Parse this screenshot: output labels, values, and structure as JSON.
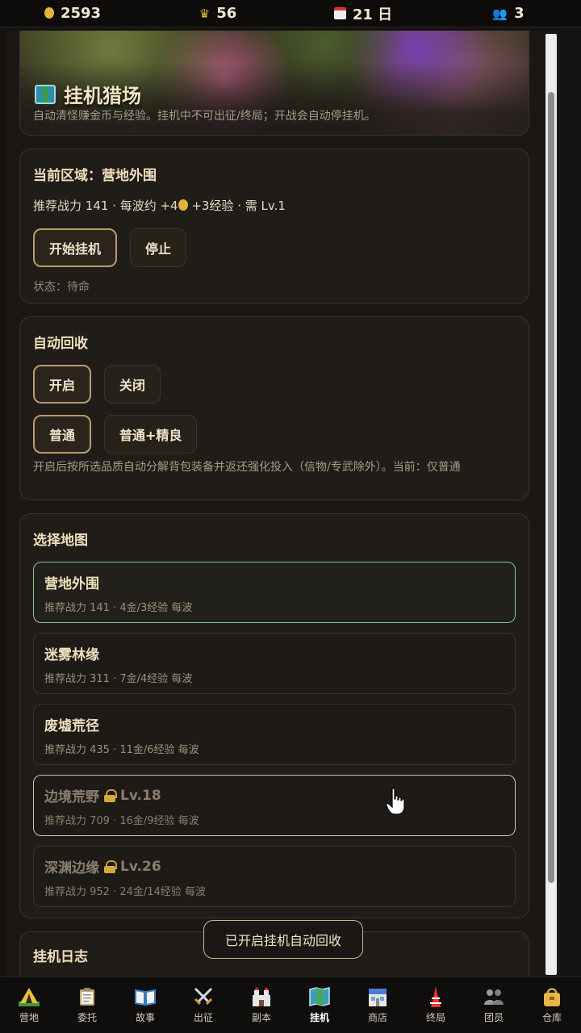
{
  "topbar": {
    "gold": "2593",
    "crowns": "56",
    "day": "21 日",
    "members": "3"
  },
  "hero": {
    "title": "挂机猎场",
    "subtitle": "自动清怪赚金币与经验。挂机中不可出征/终局；开战会自动停挂机。"
  },
  "region": {
    "heading": "当前区域：营地外围",
    "info_prefix": "推荐战力 141 · 每波约 +4",
    "info_suffix": " +3经验 · 需 Lv.1",
    "start_button": "开始挂机",
    "stop_button": "停止",
    "status": "状态：待命"
  },
  "recycle": {
    "heading": "自动回收",
    "on_button": "开启",
    "off_button": "关闭",
    "normal_button": "普通",
    "normal_fine_button": "普通+精良",
    "description": "开启后按所选品质自动分解背包装备并返还强化投入（信物/专武除外）。当前：仅普通"
  },
  "maps": {
    "heading": "选择地图",
    "items": [
      {
        "name": "营地外围",
        "lock": "",
        "info": "推荐战力 141 · 4金/3经验 每波"
      },
      {
        "name": "迷雾林缘",
        "lock": "",
        "info": "推荐战力 311 · 7金/4经验 每波"
      },
      {
        "name": "废墟荒径",
        "lock": "",
        "info": "推荐战力 435 · 11金/6经验 每波"
      },
      {
        "name": "边境荒野",
        "lock": "Lv.18",
        "info": "推荐战力 709 · 16金/9经验 每波"
      },
      {
        "name": "深渊边缘",
        "lock": "Lv.26",
        "info": "推荐战力 952 · 24金/14经验 每波"
      }
    ]
  },
  "log": {
    "heading": "挂机日志"
  },
  "toast": "已开启挂机自动回收",
  "nav": [
    {
      "label": "营地",
      "icon": "tent-icon"
    },
    {
      "label": "委托",
      "icon": "clipboard-icon"
    },
    {
      "label": "故事",
      "icon": "book-icon"
    },
    {
      "label": "出征",
      "icon": "swords-icon"
    },
    {
      "label": "副本",
      "icon": "castle-icon"
    },
    {
      "label": "挂机",
      "icon": "map-icon"
    },
    {
      "label": "商店",
      "icon": "shop-icon"
    },
    {
      "label": "终局",
      "icon": "tower-icon"
    },
    {
      "label": "团员",
      "icon": "people-icon"
    },
    {
      "label": "仓库",
      "icon": "bag-icon"
    }
  ],
  "colors": {
    "accent": "#b79c70",
    "selected_border": "#8dc5a0",
    "background": "#151311"
  }
}
